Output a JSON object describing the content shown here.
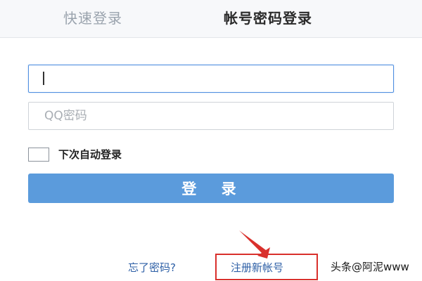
{
  "tabs": {
    "quick_login": "快速登录",
    "account_login": "帐号密码登录"
  },
  "form": {
    "username_value": "",
    "password_placeholder": "QQ密码",
    "remember_label": "下次自动登录",
    "remember_checked": false,
    "login_label": "登 录"
  },
  "links": {
    "forgot_password": "忘了密码?",
    "register": "注册新帐号"
  },
  "watermark": {
    "text": "头条@阿泥www"
  },
  "colors": {
    "primary_button": "#5b9bdc",
    "focus_border": "#4f8fe0",
    "link": "#2d5fa6",
    "annotation_red": "#d9302c"
  }
}
